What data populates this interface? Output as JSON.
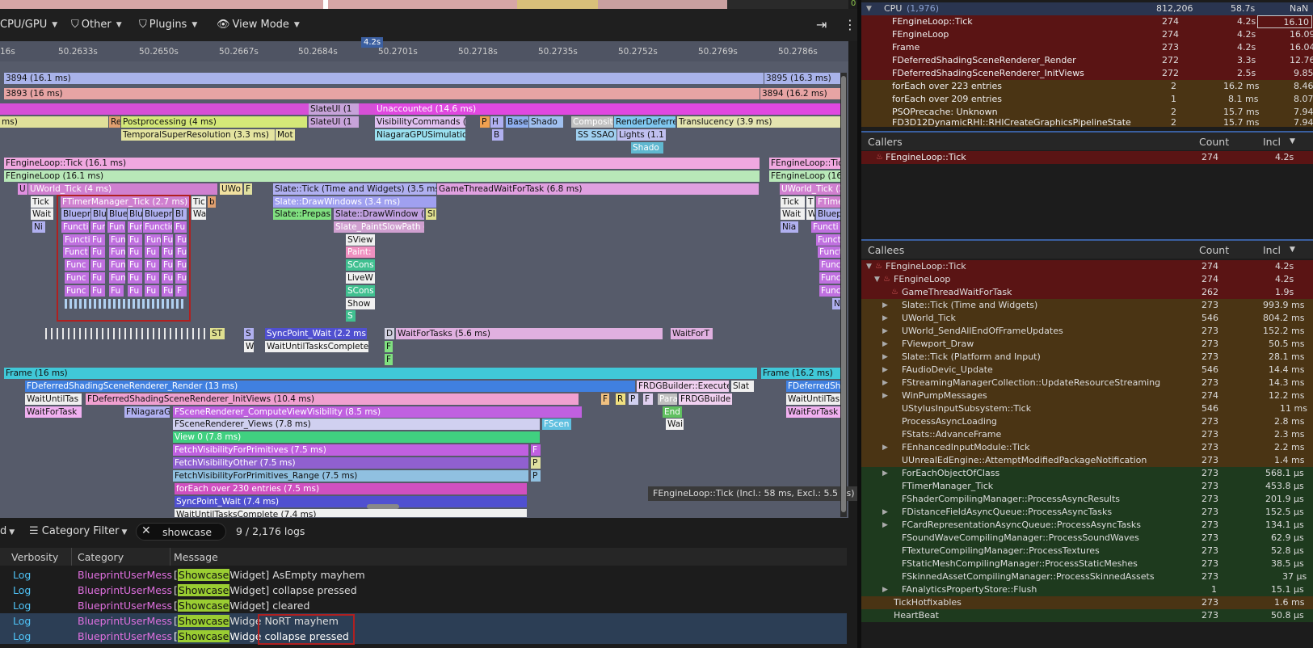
{
  "toolbar": {
    "cpu_gpu": "CPU/GPU",
    "other": "Other",
    "plugins": "Plugins",
    "view_mode": "View Mode"
  },
  "timeline": {
    "cursor_label": "4.2s",
    "ticks": [
      "16s",
      "50.2633s",
      "50.2650s",
      "50.2667s",
      "50.2684s",
      "50.2701s",
      "50.2718s",
      "50.2735s",
      "50.2752s",
      "50.2769s",
      "50.2786s"
    ],
    "frames": {
      "f3894a": "3894 (16.1 ms)",
      "f3895": "3895 (16.3 ms)",
      "f3893": "3893 (16 ms)",
      "f3894b": "3894 (16.2 ms)"
    },
    "gpu": {
      "slateui1": "SlateUI (1",
      "unaccounted": "Unaccounted (14.6 ms)",
      "ms": "ms)",
      "re": "Re",
      "postprocessing": "Postprocessing (4 ms)",
      "slateui2": "SlateUI (1",
      "visibility": "VisibilityCommands (",
      "p": "P",
      "h": "H",
      "base": "Base",
      "shado": "Shado",
      "composit": "Composit",
      "renderdeferre": "RenderDeferre",
      "translucency": "Translucency (3.9 ms)",
      "tsr": "TemporalSuperResolution (3.3 ms)",
      "mot": "Mot",
      "niagaragpu": "NiagaraGPUSimulatio",
      "b": "B",
      "ssao": "SS SSAO",
      "lights": "Lights (1.1",
      "shado2": "Shado"
    },
    "game": {
      "tick1": "FEngineLoop::Tick (16.1 ms)",
      "tick2": "FEngineLoop::Tick",
      "loop1": "FEngineLoop (16.1 ms)",
      "loop2": "FEngineLoop (16.3",
      "u": "U",
      "uworld1": "UWorld_Tick (4 ms)",
      "uwo": "UWo",
      "f": "F",
      "slatetick": "Slate::Tick (Time and Widgets) (3.5 ms)",
      "gtwait": "GameThreadWaitForTask (6.8 ms)",
      "uworld2": "UWorld_Tick (2",
      "tick": "Tick",
      "timermgr": "FTimerManager_Tick (2.7 ms)",
      "tic": "Tic",
      "bb": "b",
      "drawwindows": "Slate::DrawWindows (3.4 ms)",
      "tick_r": "Tick",
      "t_r": "T",
      "ftime_r": "FTime",
      "wait": "Wait",
      "bluepr": "Bluepr",
      "blu": "Blu",
      "blue": "Blue",
      "blu2": "Blu",
      "bluepri": "Bluepri",
      "bl": "Bl",
      "wa": "Wa",
      "slateprepas": "Slate::Prepas",
      "drawwindow2": "Slate::DrawWindow (2",
      "sl": "Sl",
      "wait_r": "Wait",
      "w_r": "W",
      "blueprr": "Bluepr",
      "ni": "Ni",
      "functi": "Functi",
      "fun": "Fun",
      "fun2": "Fun",
      "fun3": "Fun",
      "functio": "Functio",
      "fu": "Fu",
      "paintslow": "Slate_PaintSlowPath (",
      "nia_r": "Nia",
      "functi_r": "Functi",
      "sview": "SView",
      "paint": "Paint:",
      "scons": "SCons",
      "livew": "LiveW",
      "scons2": "SCons",
      "show": "Show",
      "s": "S",
      "funct": "Funct",
      "func": "Func",
      "n_r": "N"
    },
    "sync": {
      "st": "ST",
      "s": "S",
      "syncwait": "SyncPoint_Wait (2.2 ms)",
      "d": "D",
      "waitfortasks": "WaitForTasks (5.6 ms)",
      "waitfort": "WaitForT",
      "w": "W",
      "waituntil": "WaitUntilTasksComplete",
      "f1": "F",
      "f2": "F"
    },
    "render": {
      "frame1": "Frame (16 ms)",
      "frame2": "Frame (16.2 ms)",
      "deferred": "FDeferredShadingSceneRenderer_Render (13 ms)",
      "rdgexec": "FRDGBuilder::Execute",
      "slat": "Slat",
      "fdefshi": "FDeferredShi",
      "waituntilta": "WaitUntilTas",
      "initviews": "FDeferredShadingSceneRenderer_InitViews (10.4 ms)",
      "f": "F",
      "r": "R",
      "p": "P",
      "f2": "F",
      "para": "Para",
      "rdgbuild": "FRDGBuilde",
      "waituntilta_r": "WaitUntilTas",
      "waitfortask": "WaitForTask",
      "fniagara": "FNiagaraG",
      "computevis": "FSceneRenderer_ComputeViewVisibility (8.5 ms)",
      "end": "End",
      "waitfortask_r": "WaitForTask",
      "views": "FSceneRenderer_Views (7.8 ms)",
      "fscen": "FScen",
      "wai": "Wai",
      "view0": "View 0 (7.8 ms)",
      "fetchprim": "FetchVisibilityForPrimitives (7.5 ms)",
      "fp": "F",
      "fetchother": "FetchVisibilityOther (7.5 ms)",
      "po": "P",
      "fetchrange": "FetchVisibilityForPrimitives_Range (7.5 ms)",
      "pr": "P",
      "foreach": "forEach over 230 entries (7.5 ms)",
      "syncwait2": "SyncPoint_Wait (7.4 ms)",
      "waituntilcomp": "WaitUntilTasksComplete (7.4 ms)"
    },
    "tooltip": "FEngineLoop::Tick (Incl.: 58 ms, Excl.: 5.5 µs)"
  },
  "logs": {
    "d_label": "d",
    "category_filter": "Category Filter",
    "search_value": "showcase",
    "count": "9 / 2,176 logs",
    "headers": {
      "verbosity": "Verbosity",
      "category": "Category",
      "message": "Message"
    },
    "rows": [
      {
        "verbosity": "Log",
        "category": "BlueprintUserMess",
        "hl": "Showcase",
        "tag": "Widget]",
        "msg": "AsEmpty mayhem"
      },
      {
        "verbosity": "Log",
        "category": "BlueprintUserMess",
        "hl": "Showcase",
        "tag": "Widget]",
        "msg": "collapse pressed"
      },
      {
        "verbosity": "Log",
        "category": "BlueprintUserMess",
        "hl": "Showcase",
        "tag": "Widget]",
        "msg": "cleared"
      },
      {
        "verbosity": "Log",
        "category": "BlueprintUserMess",
        "hl": "Showcase",
        "tag": "Widge",
        "msg": "NoRT mayhem"
      },
      {
        "verbosity": "Log",
        "category": "BlueprintUserMess",
        "hl": "Showcase",
        "tag": "Widge",
        "msg": "collapse pressed"
      }
    ]
  },
  "timers": {
    "counter": "0",
    "cpu_label": "CPU",
    "cpu_count": "(1,976)",
    "cpu_total": "812,206",
    "cpu_time": "58.7s",
    "cpu_nan": "NaN",
    "rows": [
      {
        "name": "FEngineLoop::Tick",
        "count": "274",
        "incl": "4.2s",
        "pct": "16.10"
      },
      {
        "name": "FEngineLoop",
        "count": "274",
        "incl": "4.2s",
        "pct": "16.09"
      },
      {
        "name": "Frame",
        "count": "273",
        "incl": "4.2s",
        "pct": "16.04"
      },
      {
        "name": "FDeferredShadingSceneRenderer_Render",
        "count": "272",
        "incl": "3.3s",
        "pct": "12.76"
      },
      {
        "name": "FDeferredShadingSceneRenderer_InitViews",
        "count": "272",
        "incl": "2.5s",
        "pct": "9.85"
      },
      {
        "name": "forEach over 223 entries",
        "count": "2",
        "incl": "16.2 ms",
        "pct": "8.46"
      },
      {
        "name": "forEach over 209 entries",
        "count": "1",
        "incl": "8.1 ms",
        "pct": "8.07"
      },
      {
        "name": "PSOPrecache: Unknown",
        "count": "2",
        "incl": "15.7 ms",
        "pct": "7.94"
      },
      {
        "name": "FD3D12DynamicRHI::RHICreateGraphicsPipelineState",
        "count": "2",
        "incl": "15.7 ms",
        "pct": "7.94"
      }
    ]
  },
  "callers": {
    "title": "Callers",
    "count_header": "Count",
    "incl_header": "Incl",
    "rows": [
      {
        "name": "FEngineLoop::Tick",
        "count": "274",
        "incl": "4.2s"
      }
    ]
  },
  "callees": {
    "title": "Callees",
    "count_header": "Count",
    "incl_header": "Incl",
    "rows": [
      {
        "name": "FEngineLoop::Tick",
        "count": "274",
        "incl": "4.2s"
      },
      {
        "name": "FEngineLoop",
        "count": "274",
        "incl": "4.2s"
      },
      {
        "name": "GameThreadWaitForTask",
        "count": "262",
        "incl": "1.9s"
      },
      {
        "name": "Slate::Tick (Time and Widgets)",
        "count": "273",
        "incl": "993.9 ms"
      },
      {
        "name": "UWorld_Tick",
        "count": "546",
        "incl": "804.2 ms"
      },
      {
        "name": "UWorld_SendAllEndOfFrameUpdates",
        "count": "273",
        "incl": "152.2 ms"
      },
      {
        "name": "FViewport_Draw",
        "count": "273",
        "incl": "50.5 ms"
      },
      {
        "name": "Slate::Tick (Platform and Input)",
        "count": "273",
        "incl": "28.1 ms"
      },
      {
        "name": "FAudioDevic_Update",
        "count": "546",
        "incl": "14.4 ms"
      },
      {
        "name": "FStreamingManagerCollection::UpdateResourceStreaming",
        "count": "273",
        "incl": "14.3 ms"
      },
      {
        "name": "WinPumpMessages",
        "count": "274",
        "incl": "12.2 ms"
      },
      {
        "name": "UStylusInputSubsystem::Tick",
        "count": "546",
        "incl": "11 ms"
      },
      {
        "name": "ProcessAsyncLoading",
        "count": "273",
        "incl": "2.8 ms"
      },
      {
        "name": "FStats::AdvanceFrame",
        "count": "273",
        "incl": "2.3 ms"
      },
      {
        "name": "FEnhancedInputModule::Tick",
        "count": "273",
        "incl": "2.2 ms"
      },
      {
        "name": "UUnrealEdEngine::AttemptModifiedPackageNotification",
        "count": "273",
        "incl": "1.4 ms"
      },
      {
        "name": "ForEachObjectOfClass",
        "count": "273",
        "incl": "568.1 µs"
      },
      {
        "name": "FTimerManager_Tick",
        "count": "273",
        "incl": "453.8 µs"
      },
      {
        "name": "FShaderCompilingManager::ProcessAsyncResults",
        "count": "273",
        "incl": "201.9 µs"
      },
      {
        "name": "FDistanceFieldAsyncQueue::ProcessAsyncTasks",
        "count": "273",
        "incl": "152.5 µs"
      },
      {
        "name": "FCardRepresentationAsyncQueue::ProcessAsyncTasks",
        "count": "273",
        "incl": "134.1 µs"
      },
      {
        "name": "FSoundWaveCompilingManager::ProcessSoundWaves",
        "count": "273",
        "incl": "62.9 µs"
      },
      {
        "name": "FTextureCompilingManager::ProcessTextures",
        "count": "273",
        "incl": "52.8 µs"
      },
      {
        "name": "FStaticMeshCompilingManager::ProcessStaticMeshes",
        "count": "273",
        "incl": "38.5 µs"
      },
      {
        "name": "FSkinnedAssetCompilingManager::ProcessSkinnedAssets",
        "count": "273",
        "incl": "37 µs"
      },
      {
        "name": "FAnalyticsPropertyStore::Flush",
        "count": "1",
        "incl": "15.1 µs"
      },
      {
        "name": "TickHotfixables",
        "count": "273",
        "incl": "1.6 ms"
      },
      {
        "name": "HeartBeat",
        "count": "273",
        "incl": "50.8 µs"
      }
    ]
  },
  "colors": {
    "panel_bg": "#1c1c1c",
    "timeline_bg": "#565b6a",
    "hot_row": "#5a1414",
    "warm_row": "#4a3414",
    "cool_row": "#1e3a1e"
  }
}
